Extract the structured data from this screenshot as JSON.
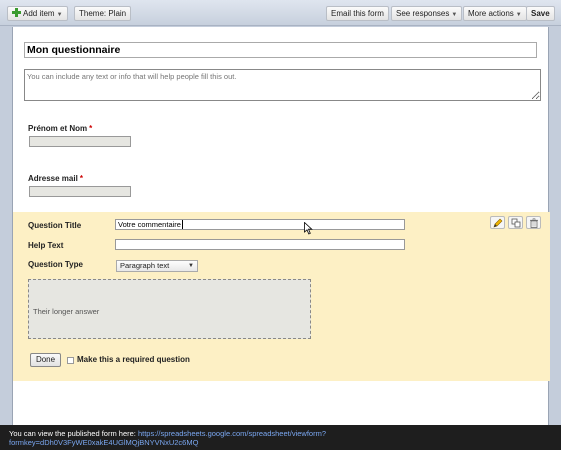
{
  "toolbar": {
    "add_item": "Add item",
    "theme": "Theme:  Plain",
    "email_form": "Email this form",
    "see_responses": "See responses",
    "more_actions": "More actions",
    "save": "Save"
  },
  "form": {
    "title": "Mon questionnaire",
    "description_placeholder": "You can include any text or info that will help people fill this out."
  },
  "questions": [
    {
      "label": "Prénom et Nom",
      "required_mark": "*"
    },
    {
      "label": "Adresse mail",
      "required_mark": "*"
    }
  ],
  "editor": {
    "title_label": "Question Title",
    "title_value": "Votre commentaire",
    "help_label": "Help Text",
    "help_value": "",
    "type_label": "Question Type",
    "type_value": "Paragraph text",
    "preview_text": "Their longer answer",
    "done": "Done",
    "required_label": "Make this a required question",
    "required_checked": false
  },
  "icons": [
    "plus-icon",
    "pencil-icon",
    "duplicate-icon",
    "trash-icon",
    "mouse-cursor-icon"
  ],
  "footer": {
    "text": "You can view the published form here: ",
    "link_line1": "https://spreadsheets.google.com/spreadsheet/viewform?",
    "link_line2": "formkey=dDh0V3FyWE0xakE4UGlMQjBNYVNxU2c6MQ"
  }
}
